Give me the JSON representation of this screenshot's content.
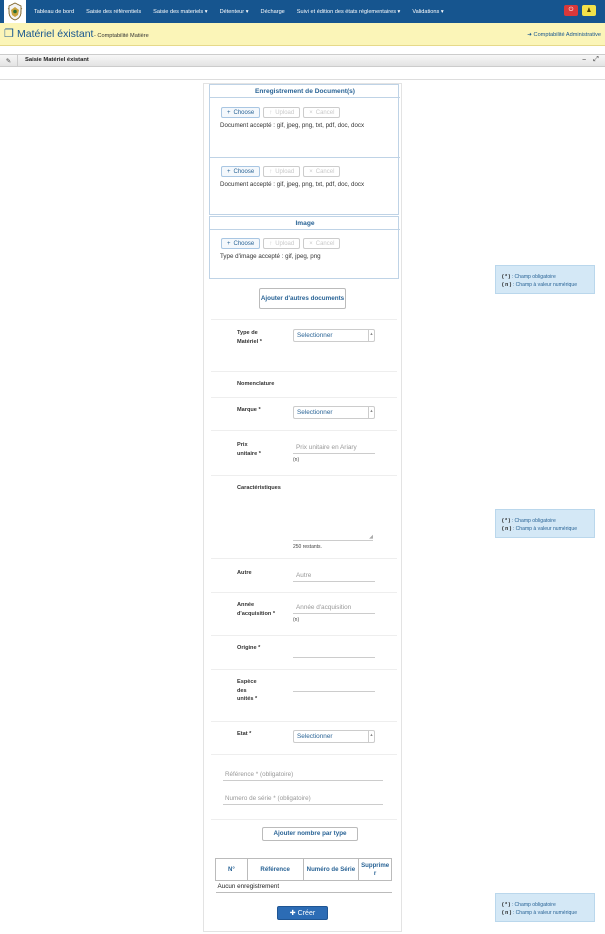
{
  "navbar": {
    "items": [
      "Tableau de bord",
      "Saisie des référentiels",
      "Saisie des materiels ▾",
      "Détenteur ▾",
      "Décharge",
      "Suivi et édition des états réglementaires ▾",
      "Validations ▾"
    ],
    "power_icon": "power-icon",
    "user_icon": "user-icon"
  },
  "header": {
    "title": "Matériel éxistant",
    "subtitle": "- Comptabilité Matière",
    "right_link": "Comptabilité Administrative"
  },
  "panel": {
    "title": "Saisie Matériel éxistant"
  },
  "documents": {
    "title": "Enregistrement de Document(s)",
    "choose": "Choose",
    "upload": "Upload",
    "cancel": "Cancel",
    "accept_text": "Document accepté : gif, jpeg, png, txt, pdf, doc, docx"
  },
  "image": {
    "title": "Image",
    "accept_text": "Type d'image accepté : gif, jpeg, png"
  },
  "add_docs_button": "Ajouter d'autres documents",
  "form": {
    "type_materiel": {
      "label": "Type de Matériel *",
      "value": "Selectionner"
    },
    "nomenclature": {
      "label": "Nomenclature"
    },
    "marque": {
      "label": "Marque *",
      "value": "Selectionner"
    },
    "prix": {
      "label": "Prix unitaire *",
      "placeholder": "Prix unitaire en Ariary",
      "hint": "(n)"
    },
    "caracteristiques": {
      "label": "Caractéristiques",
      "remaining": "250 restants."
    },
    "autre": {
      "label": "Autre",
      "placeholder": "Autre"
    },
    "annee": {
      "label": "Année d'acquisition *",
      "placeholder": "Année d'acquisition",
      "hint": "(n)"
    },
    "origine": {
      "label": "Origine *"
    },
    "espece": {
      "label": "Espèce des unités *"
    },
    "etat": {
      "label": "Etat *",
      "value": "Selectionner"
    },
    "reference": {
      "placeholder": "Référence * (obligatoire)"
    },
    "numero_serie": {
      "placeholder": "Numero de série * (obligatoire)"
    }
  },
  "add_per_type_button": "Ajouter nombre par type",
  "table": {
    "headers": [
      "N°",
      "Référence",
      "Numéro de Série",
      "Supprimer"
    ],
    "empty": "Aucun enregistrement"
  },
  "create_button": "Créer",
  "legend": {
    "required_sym": "( * )",
    "required_text": ": Champ obligatoire",
    "numeric_sym": "( n )",
    "numeric_text": ": Champ à valeur numérique"
  }
}
